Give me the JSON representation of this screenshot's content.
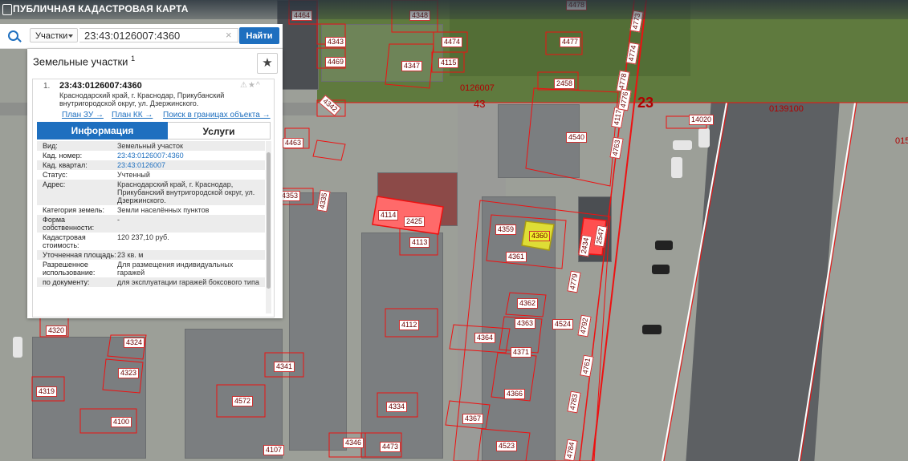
{
  "app": {
    "title": "ПУБЛИЧНАЯ КАДАСТРОВАЯ КАРТА"
  },
  "search": {
    "type_label": "Участки",
    "query": "23:43:0126007:4360",
    "find_label": "Найти"
  },
  "results": {
    "title": "Земельные участки",
    "count": "1",
    "item": {
      "number": "1.",
      "cad_number": "23:43:0126007:4360",
      "address": "Краснодарский край, г. Краснодар, Прикубанский внутригородской округ, ул. Дзержинского.",
      "links": [
        "План ЗУ →",
        "План КК →",
        "Поиск в границах объекта →"
      ]
    },
    "tabs": [
      "Информация",
      "Услуги"
    ],
    "fields": [
      {
        "k": "Вид:",
        "v": "Земельный участок"
      },
      {
        "k": "Кад. номер:",
        "v": "23:43:0126007:4360"
      },
      {
        "k": "Кад. квартал:",
        "v": "23:43:0126007"
      },
      {
        "k": "Статус:",
        "v": "Учтенный"
      },
      {
        "k": "Адрес:",
        "v": "Краснодарский край, г. Краснодар, Прикубанский внутригородской округ, ул. Дзержинского."
      },
      {
        "k": "Категория земель:",
        "v": "Земли населённых пунктов"
      },
      {
        "k": "Форма собственности:",
        "v": "-"
      },
      {
        "k": "Кадастровая стоимость:",
        "v": "120 237,10 руб."
      },
      {
        "k": "Уточненная площадь:",
        "v": "23 кв. м"
      },
      {
        "k": "Разрешенное использование:",
        "v": "Для размещения индивидуальных гаражей"
      },
      {
        "k": "по документу:",
        "v": "для эксплуатации гаражей боксового типа"
      }
    ]
  },
  "map": {
    "parcel_labels": [
      "4464",
      "4348",
      "4478",
      "4343",
      "4474",
      "4477",
      "4469",
      "4347",
      "4115",
      "4114",
      "2425",
      "4113",
      "4359",
      "4360",
      "4361",
      "2434",
      "2547",
      "4362",
      "4363",
      "4364",
      "4371",
      "4366",
      "4367",
      "4112",
      "4324",
      "4323",
      "4341",
      "4320",
      "4319",
      "4572",
      "4334",
      "4100",
      "4107",
      "4346",
      "4473",
      "4523",
      "4524",
      "4540",
      "2458",
      "4463",
      "4342",
      "4335",
      "4112",
      "4783",
      "4784",
      "4779",
      "4778",
      "4792",
      "4762",
      "4761",
      "4117",
      "4776",
      "14020",
      "4763",
      "4773",
      "4774",
      "4353"
    ],
    "quarter_labels": [
      "0126007",
      "0139100",
      "43",
      "23",
      "015"
    ],
    "district_label": "23"
  }
}
